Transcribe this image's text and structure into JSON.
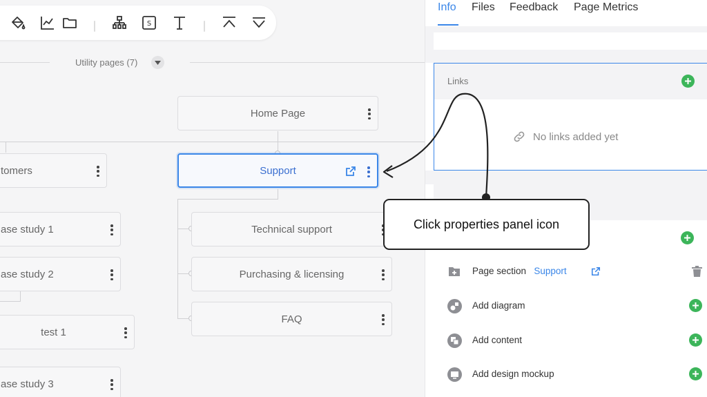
{
  "toolbar": {
    "icons": [
      "paint-bucket-icon",
      "line-chart-icon",
      "folder-icon",
      "sitemap-icon",
      "dollar-box-icon",
      "text-icon",
      "collapse-up-icon",
      "expand-down-icon"
    ]
  },
  "canvas": {
    "utility_pages_label": "Utility pages (7)",
    "nodes": {
      "home": "Home Page",
      "support": "Support",
      "customers": "tomers",
      "case_study_1": "ase study 1",
      "case_study_2": "ase study 2",
      "test_1": "test 1",
      "case_study_3": "ase study 3",
      "technical_support": "Technical support",
      "purchasing": "Purchasing & licensing",
      "faq": "FAQ"
    }
  },
  "panel": {
    "tabs": [
      {
        "label": "Info",
        "active": true
      },
      {
        "label": "Files",
        "active": false
      },
      {
        "label": "Feedback",
        "active": false
      },
      {
        "label": "Page Metrics",
        "active": false
      }
    ],
    "links": {
      "label": "Links",
      "empty_text": "No links added yet"
    },
    "rows": [
      {
        "label": "Page section",
        "link": "Support",
        "action": "trash"
      },
      {
        "label": "Add diagram",
        "action": "add"
      },
      {
        "label": "Add content",
        "action": "add"
      },
      {
        "label": "Add design mockup",
        "action": "add"
      }
    ]
  },
  "callout": {
    "text": "Click properties panel icon"
  },
  "colors": {
    "accent": "#3a86e8",
    "add_green": "#3cb55a",
    "canvas_bg": "#f5f5f6"
  }
}
